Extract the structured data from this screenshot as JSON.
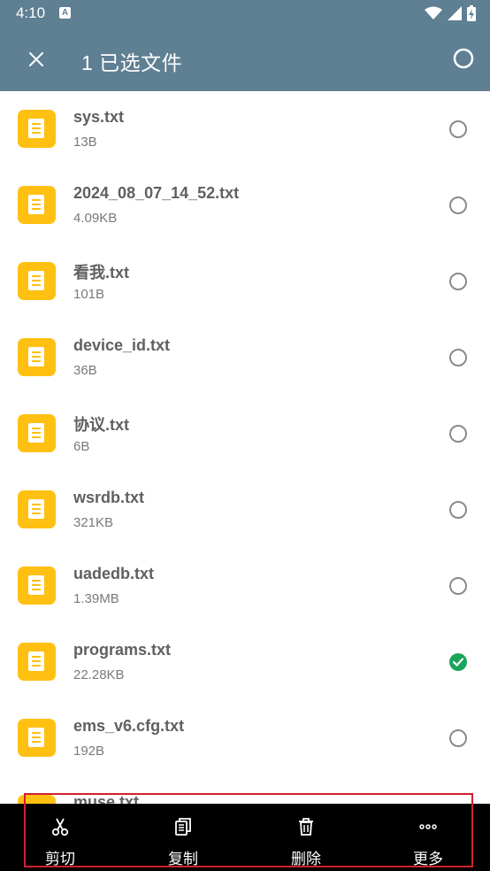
{
  "status": {
    "time": "4:10",
    "app_badge": "A"
  },
  "toolbar": {
    "title": "1 已选文件"
  },
  "files": [
    {
      "name": "sys.txt",
      "size": "13B",
      "selected": false
    },
    {
      "name": "2024_08_07_14_52.txt",
      "size": "4.09KB",
      "selected": false
    },
    {
      "name": "看我.txt",
      "size": "101B",
      "selected": false
    },
    {
      "name": "device_id.txt",
      "size": "36B",
      "selected": false
    },
    {
      "name": "协议.txt",
      "size": "6B",
      "selected": false
    },
    {
      "name": "wsrdb.txt",
      "size": "321KB",
      "selected": false
    },
    {
      "name": "uadedb.txt",
      "size": "1.39MB",
      "selected": false
    },
    {
      "name": "programs.txt",
      "size": "22.28KB",
      "selected": true
    },
    {
      "name": "ems_v6.cfg.txt",
      "size": "192B",
      "selected": false
    },
    {
      "name": "muse.txt",
      "size": "",
      "selected": false
    }
  ],
  "actions": [
    {
      "label": "剪切",
      "icon": "scissors-icon"
    },
    {
      "label": "复制",
      "icon": "copy-icon"
    },
    {
      "label": "删除",
      "icon": "trash-icon"
    },
    {
      "label": "更多",
      "icon": "more-icon"
    }
  ],
  "colors": {
    "header": "#5f7f93",
    "file_icon": "#ffc012",
    "selected": "#1aa55c",
    "highlight": "#d11f2e"
  }
}
